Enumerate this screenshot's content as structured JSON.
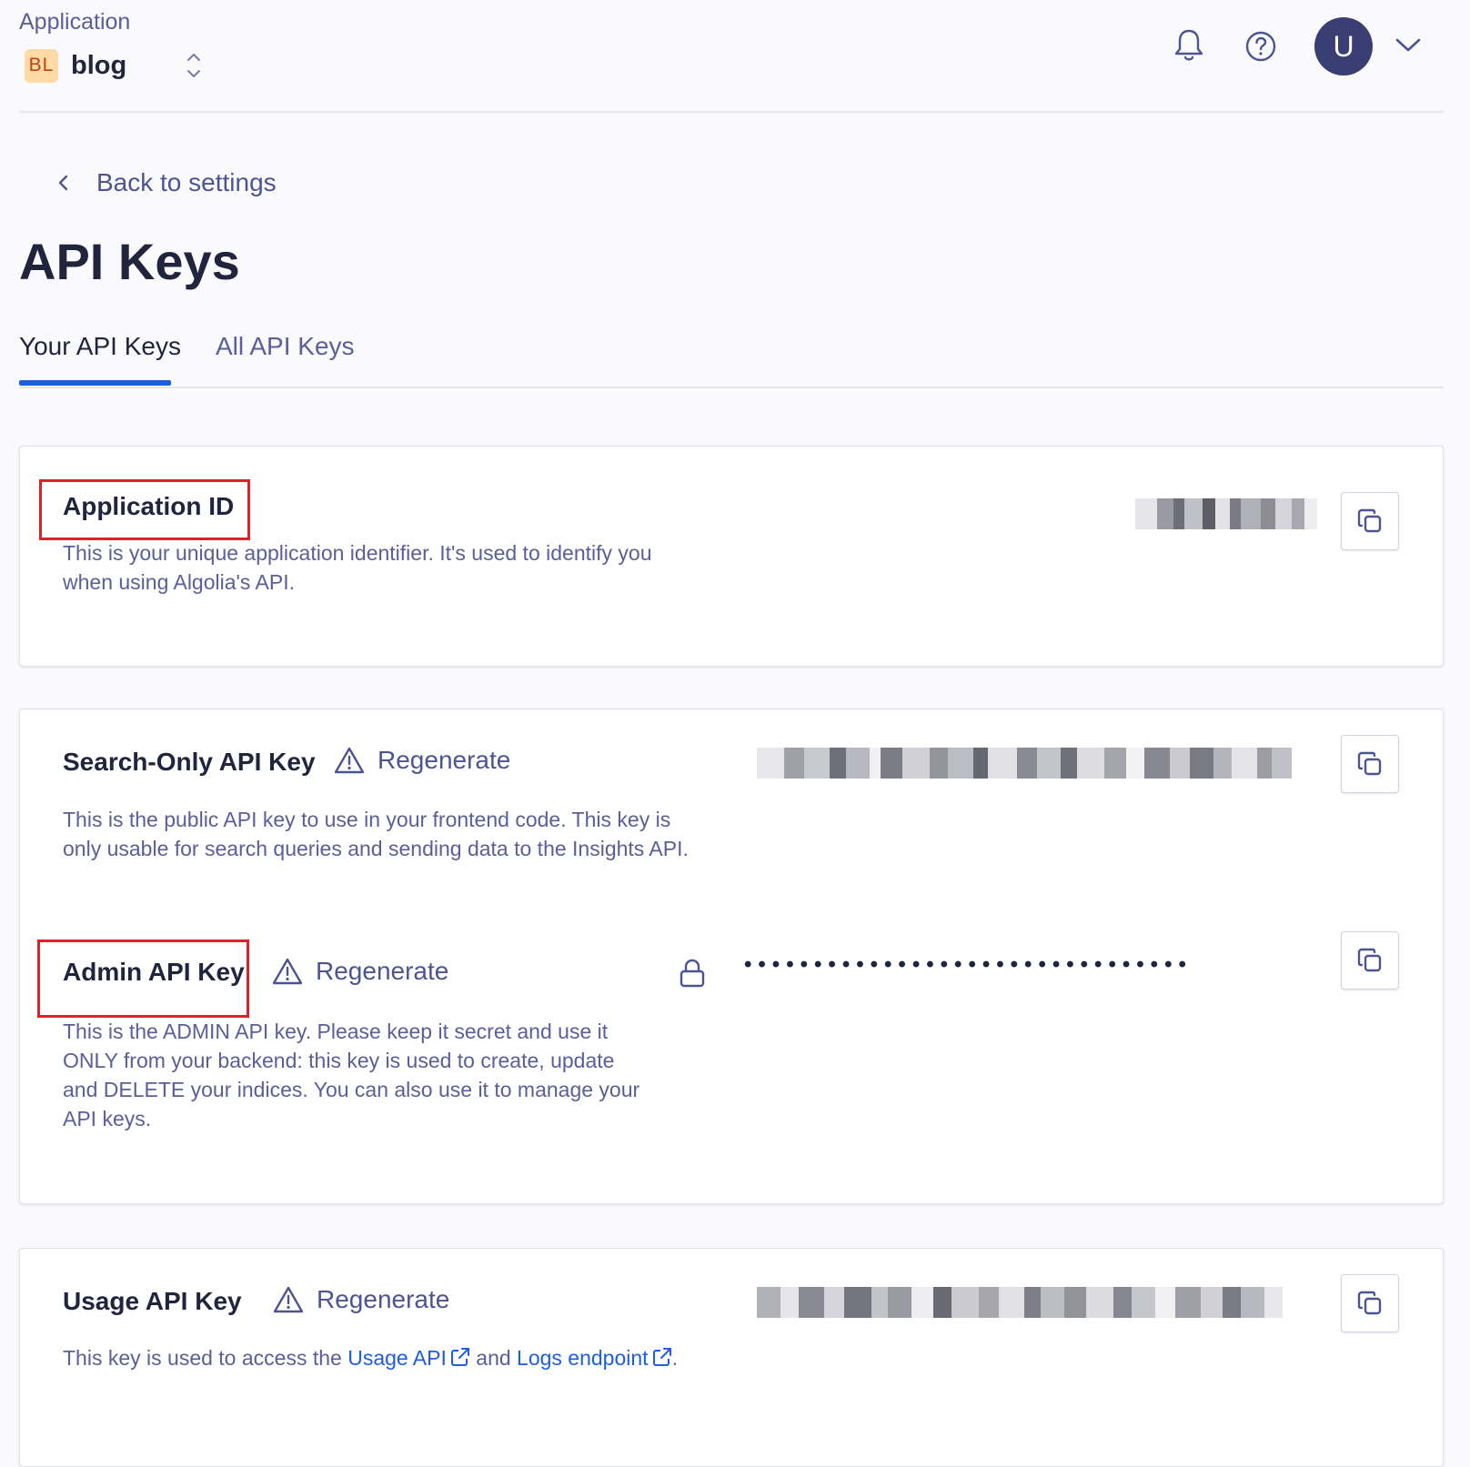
{
  "header": {
    "app_label": "Application",
    "app_badge": "BL",
    "app_name": "blog",
    "avatar_initial": "U"
  },
  "nav": {
    "back_label": "Back to settings"
  },
  "page": {
    "title": "API Keys"
  },
  "tabs": [
    {
      "label": "Your API Keys",
      "active": true
    },
    {
      "label": "All API Keys",
      "active": false
    }
  ],
  "application_id": {
    "title": "Application ID",
    "description": "This is your unique application identifier. It's used to identify you when using Algolia's API."
  },
  "search_key": {
    "title": "Search-Only API Key",
    "regenerate": "Regenerate",
    "description": "This is the public API key to use in your frontend code. This key is only usable for search queries and sending data to the Insights API."
  },
  "admin_key": {
    "title": "Admin API Key",
    "regenerate": "Regenerate",
    "masked_value": "••••••••••••••••••••••••••••••••",
    "description": "This is the ADMIN API key. Please keep it secret and use it ONLY from your backend: this key is used to create, update and DELETE your indices. You can also use it to manage your API keys."
  },
  "usage_key": {
    "title": "Usage API Key",
    "regenerate": "Regenerate",
    "desc_prefix": "This key is used to access the",
    "link_usage": "Usage API",
    "desc_middle": "and",
    "link_logs": "Logs endpoint",
    "desc_suffix": "."
  },
  "colors": {
    "accent": "#1d5ee0",
    "highlight": "#e3202a",
    "avatar_bg": "#3a3f73",
    "text_secondary": "#5a5e9a"
  },
  "icons": [
    "chevron-updown-icon",
    "bell-icon",
    "help-icon",
    "chevron-down-icon",
    "chevron-left-icon",
    "warning-icon",
    "copy-icon",
    "lock-icon",
    "external-link-icon"
  ]
}
